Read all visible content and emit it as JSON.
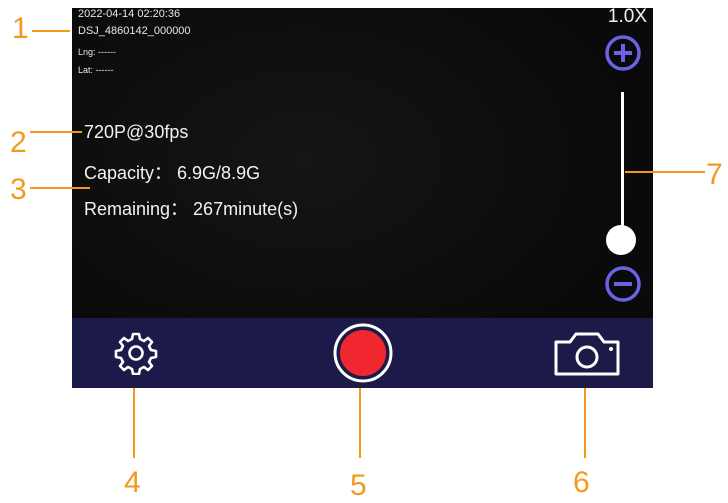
{
  "overlay": {
    "timestamp": "2022-04-14  02:20:36",
    "device_id": "DSJ_4860142_000000",
    "lng": "Lng: ------",
    "lat": "Lat: ------",
    "resolution": "720P@30fps",
    "capacity": "Capacity： 6.9G/8.9G",
    "remaining": "Remaining： 267minute(s)"
  },
  "zoom": {
    "label": "1.0X",
    "level_fraction": 0.0
  },
  "bottom_bar": {
    "settings_icon": "gear-icon",
    "record_icon": "record-icon",
    "snapshot_icon": "camera-icon"
  },
  "callouts": [
    "1",
    "2",
    "3",
    "4",
    "5",
    "6",
    "7"
  ],
  "colors": {
    "screen_bg": "#0b0b0b",
    "bar_bg": "#1c1a48",
    "record_red": "#f0272e",
    "zoom_button": "#6b63e6",
    "callout_orange": "#f39a1e"
  }
}
